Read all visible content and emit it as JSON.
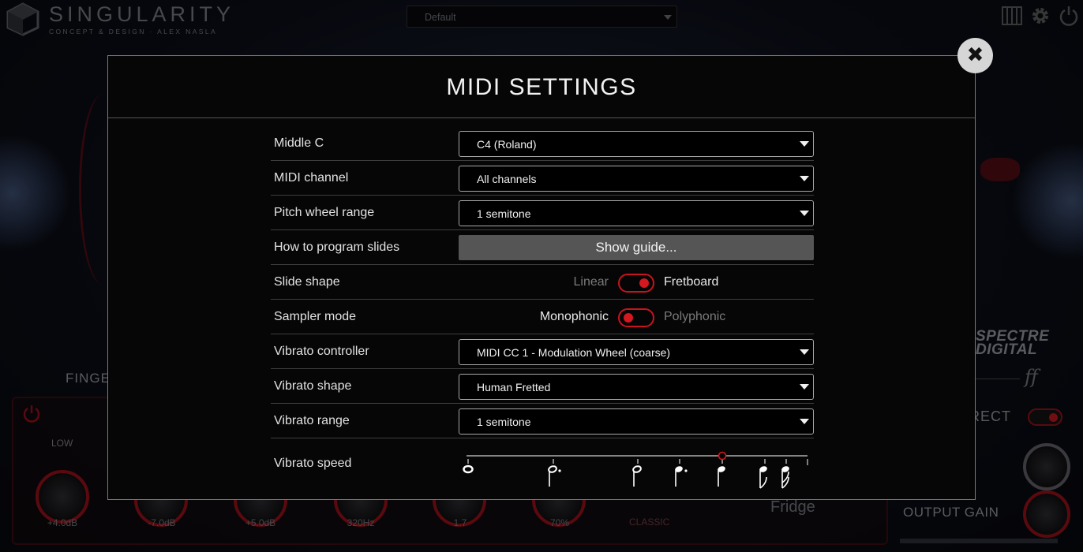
{
  "app": {
    "logo_title": "SINGULARITY",
    "logo_subtitle": "CONCEPT & DESIGN · ALEX NASLA",
    "preset": "Default",
    "icons": [
      "piano-keys-icon",
      "gear-icon",
      "power-icon"
    ]
  },
  "background": {
    "finger_label": "FINGER",
    "low_label": "LOW",
    "knob_values": [
      "+4.0dB",
      "-7.0dB",
      "+5.0dB",
      "320Hz",
      "1.7",
      "70%"
    ],
    "classic_label": "CLASSIC",
    "fridge_label": "Fridge",
    "brand_line1": "SPECTRE",
    "brand_line2": "DIGITAL",
    "ff_mark": "ff",
    "rect_label": "RECT",
    "output_gain_label": "OUTPUT GAIN"
  },
  "modal": {
    "title": "MIDI SETTINGS",
    "close_glyph": "✖",
    "rows": {
      "middle_c": {
        "label": "Middle C",
        "value": "C4 (Roland)"
      },
      "midi_channel": {
        "label": "MIDI channel",
        "value": "All channels"
      },
      "pitch_wheel": {
        "label": "Pitch wheel range",
        "value": "1 semitone"
      },
      "slides": {
        "label": "How to program slides",
        "button": "Show guide..."
      },
      "slide_shape": {
        "label": "Slide shape",
        "left": "Linear",
        "right": "Fretboard",
        "selected": "right"
      },
      "sampler_mode": {
        "label": "Sampler mode",
        "left": "Monophonic",
        "right": "Polyphonic",
        "selected": "left"
      },
      "vibrato_controller": {
        "label": "Vibrato controller",
        "value": "MIDI CC 1 - Modulation Wheel (coarse)"
      },
      "vibrato_shape": {
        "label": "Vibrato shape",
        "value": "Human Fretted"
      },
      "vibrato_range": {
        "label": "Vibrato range",
        "value": "1 semitone"
      },
      "vibrato_speed": {
        "label": "Vibrato speed",
        "marks": [
          "whole-note-icon",
          "dotted-half-note-icon",
          "half-note-icon",
          "dotted-quarter-note-icon",
          "quarter-note-icon",
          "eighth-note-icon",
          "sixteenth-note-icon"
        ],
        "selected": "quarter-note-icon"
      }
    }
  },
  "colors": {
    "accent": "#d31820",
    "modal_bg": "#060606",
    "text": "#e2e2e2",
    "muted": "#7a7a7a"
  }
}
